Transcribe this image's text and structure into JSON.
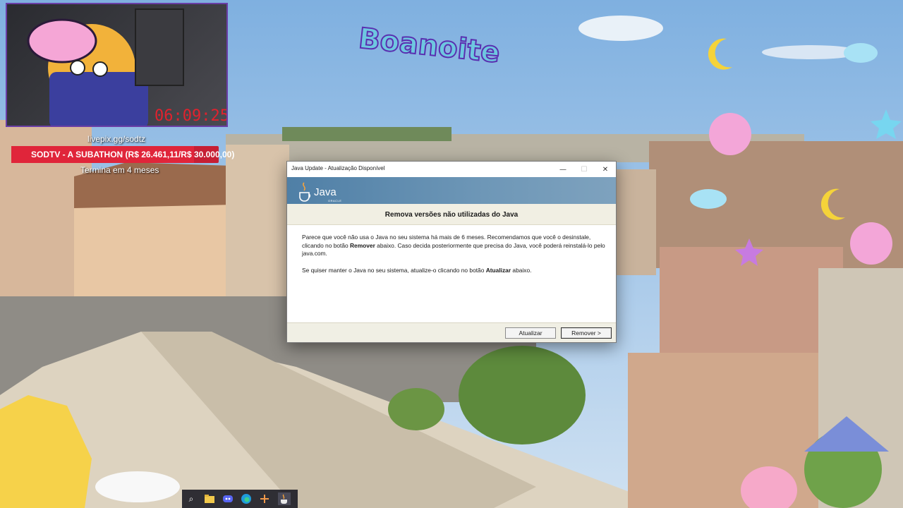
{
  "overlay": {
    "timer": "06:09:25",
    "stream_link": "livepix.gg/sodtz",
    "goal_text": "SODTV - A SUBATHON (R$ 26.461,11/R$ 30.000,00)",
    "goal_progress": 0.882,
    "goal_sub": "Termina em 4 meses",
    "title_sticker": "Boanoite"
  },
  "dialog": {
    "title": "Java Update - Atualização Disponível",
    "logo_text": "Java",
    "logo_sub": "ORACLE",
    "heading": "Remova versões não utilizadas do Java",
    "paragraph1_a": "Parece que você não usa o Java no seu sistema há mais de 6 meses. Recomendamos que você o desinstale, clicando no botão ",
    "paragraph1_bold": "Remover",
    "paragraph1_b": " abaixo. Caso decida posteriormente que precisa do Java, você poderá reinstalá-lo pelo java.com.",
    "paragraph2_a": "Se quiser manter o Java no seu sistema, atualize-o clicando no botão ",
    "paragraph2_bold": "Atualizar",
    "paragraph2_b": " abaixo.",
    "update_button": "Atualizar",
    "remove_button": "Remover >",
    "minimize_glyph": "—",
    "maximize_glyph": "☐",
    "close_glyph": "✕"
  },
  "taskbar": {
    "icons": [
      "search-icon",
      "folder-icon",
      "discord-icon",
      "edge-icon",
      "tool-icon",
      "java-icon"
    ]
  },
  "colors": {
    "banner": "#5f8cb0",
    "goal_bar": "#c61f34",
    "timer": "#e0222e"
  }
}
